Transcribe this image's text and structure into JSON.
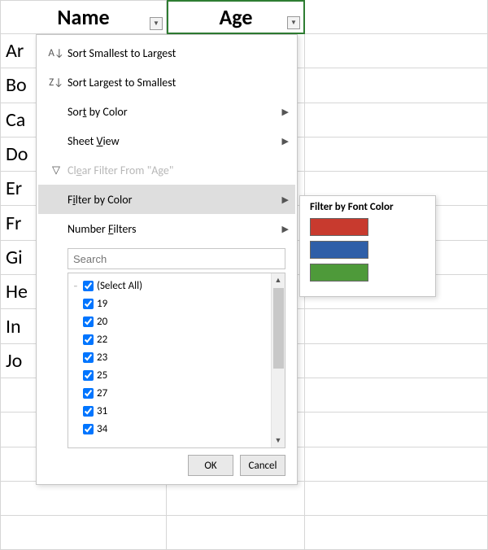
{
  "headers": {
    "col_a": "Name",
    "col_b": "Age"
  },
  "rows": [
    "Ar",
    "Bo",
    "Ca",
    "Do",
    "Er",
    "Fr",
    "Gi",
    "He",
    "In",
    "Jo"
  ],
  "menu": {
    "sort_asc": "Sort Smallest to Largest",
    "sort_desc": "Sort Largest to Smallest",
    "sort_color_pre": "Sor",
    "sort_color_u": "t",
    "sort_color_post": " by Color",
    "sheet_view_pre": "Sheet ",
    "sheet_view_u": "V",
    "sheet_view_post": "iew",
    "clear_pre": "Cl",
    "clear_u": "e",
    "clear_post": "ar Filter From \"Age\"",
    "filter_color_pre": "F",
    "filter_color_u": "i",
    "filter_color_post": "lter by Color",
    "number_filters_pre": "Number ",
    "number_filters_u": "F",
    "number_filters_post": "ilters",
    "search_placeholder": "Search",
    "items": {
      "select_all": "(Select All)",
      "v0": "19",
      "v1": "20",
      "v2": "22",
      "v3": "23",
      "v4": "25",
      "v5": "27",
      "v6": "31",
      "v7": "34"
    },
    "ok": "OK",
    "cancel": "Cancel"
  },
  "submenu": {
    "title": "Filter by Font Color"
  }
}
